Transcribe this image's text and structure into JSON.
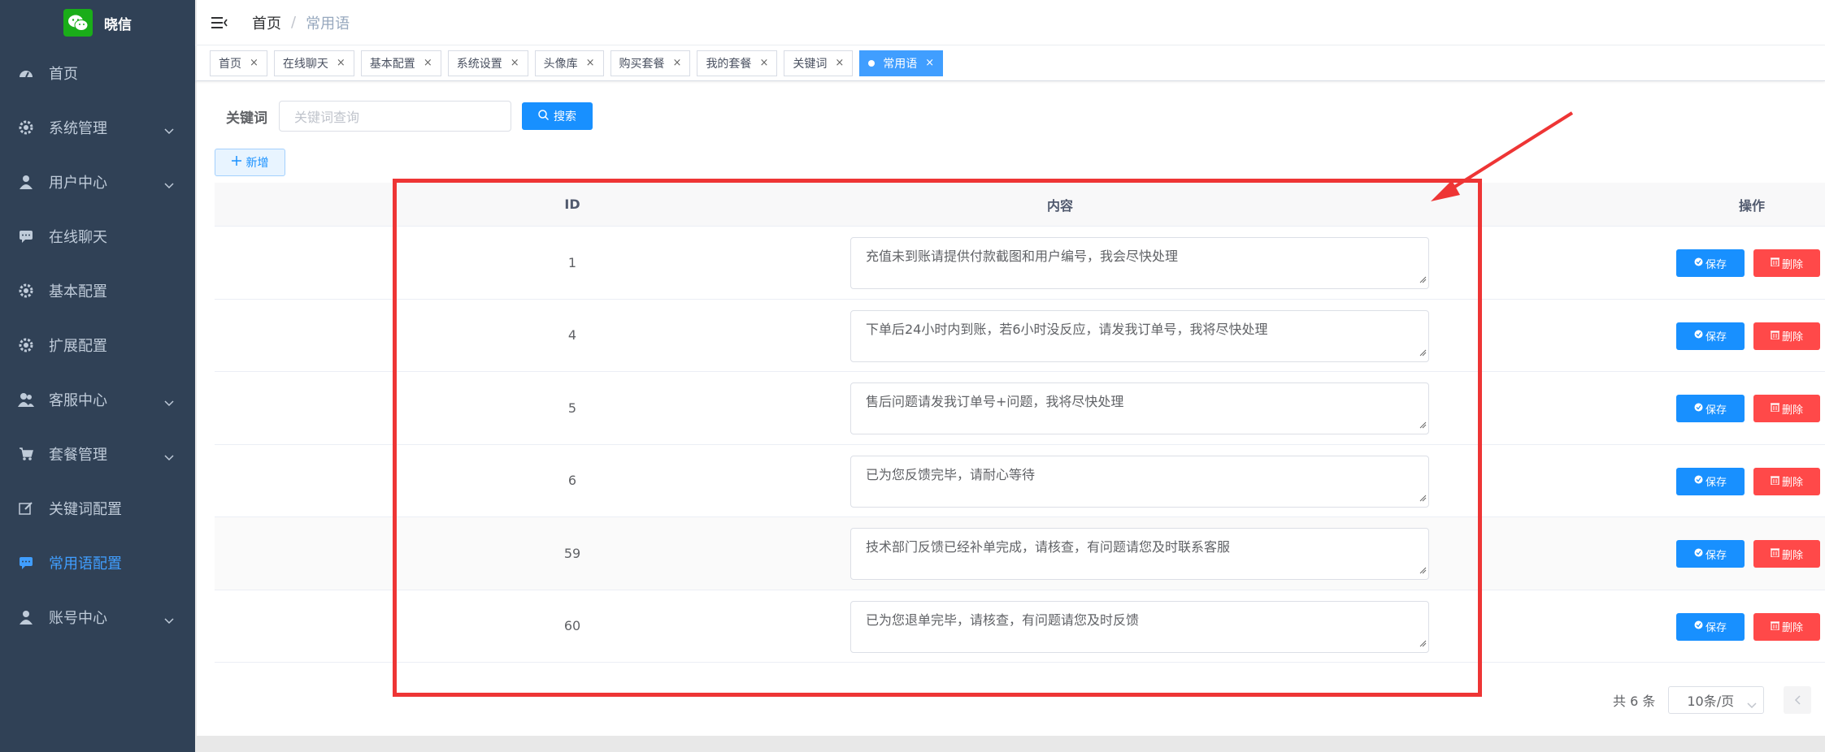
{
  "app": {
    "name": "晓信"
  },
  "colors": {
    "sidebar_bg": "#304156",
    "primary": "#1890ff",
    "danger": "#ff4949",
    "active_menu": "#409eff",
    "annotation": "#ee3535"
  },
  "sidebar": {
    "items": [
      {
        "label": "首页",
        "icon": "dashboard-icon",
        "has_arrow": false
      },
      {
        "label": "系统管理",
        "icon": "gear-icon",
        "has_arrow": true
      },
      {
        "label": "用户中心",
        "icon": "user-icon",
        "has_arrow": true
      },
      {
        "label": "在线聊天",
        "icon": "chat-icon",
        "has_arrow": false
      },
      {
        "label": "基本配置",
        "icon": "gear-icon",
        "has_arrow": false
      },
      {
        "label": "扩展配置",
        "icon": "gear-icon",
        "has_arrow": false
      },
      {
        "label": "客服中心",
        "icon": "users-icon",
        "has_arrow": true
      },
      {
        "label": "套餐管理",
        "icon": "cart-icon",
        "has_arrow": true
      },
      {
        "label": "关键词配置",
        "icon": "edit-icon",
        "has_arrow": false
      },
      {
        "label": "常用语配置",
        "icon": "chat-icon",
        "has_arrow": false,
        "active": true
      },
      {
        "label": "账号中心",
        "icon": "user-icon",
        "has_arrow": true
      }
    ]
  },
  "header": {
    "breadcrumb": {
      "home": "首页",
      "separator": "/",
      "current": "常用语"
    }
  },
  "tags": [
    {
      "label": "首页"
    },
    {
      "label": "在线聊天"
    },
    {
      "label": "基本配置"
    },
    {
      "label": "系统设置"
    },
    {
      "label": "头像库"
    },
    {
      "label": "购买套餐"
    },
    {
      "label": "我的套餐"
    },
    {
      "label": "关键词"
    },
    {
      "label": "常用语",
      "active": true
    }
  ],
  "tag_close": "×",
  "search": {
    "label": "关键词",
    "placeholder": "关键词查询",
    "button": "搜索"
  },
  "add_button": "新增",
  "table": {
    "headers": {
      "id": "ID",
      "content": "内容",
      "op": "操作"
    },
    "rows": [
      {
        "id": "1",
        "content": "充值未到账请提供付款截图和用户编号，我会尽快处理"
      },
      {
        "id": "4",
        "content": "下单后24小时内到账，若6小时没反应，请发我订单号，我将尽快处理"
      },
      {
        "id": "5",
        "content": "售后问题请发我订单号+问题，我将尽快处理"
      },
      {
        "id": "6",
        "content": "已为您反馈完毕，请耐心等待"
      },
      {
        "id": "59",
        "content": "技术部门反馈已经补单完成，请核查，有问题请您及时联系客服"
      },
      {
        "id": "60",
        "content": "已为您退单完毕，请核查，有问题请您及时反馈"
      }
    ],
    "save_label": "保存",
    "delete_label": "删除"
  },
  "pagination": {
    "total": "共 6 条",
    "page_size": "10条/页"
  }
}
